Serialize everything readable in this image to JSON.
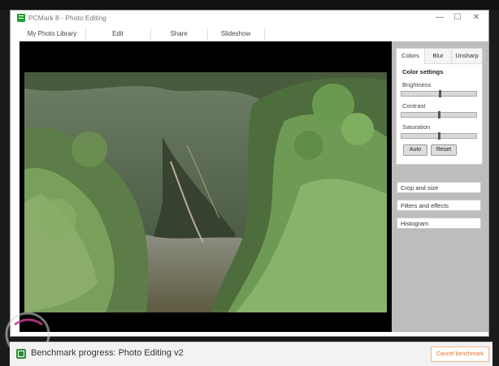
{
  "app": {
    "title": "PCMark 8 - Photo Editing"
  },
  "window_controls": {
    "minimize": "—",
    "maximize": "☐",
    "close": "✕"
  },
  "menu": {
    "items": [
      {
        "label": "My Photo Library"
      },
      {
        "label": "Edit"
      },
      {
        "label": "Share"
      },
      {
        "label": "Slideshow"
      }
    ]
  },
  "side_panel": {
    "tabs": [
      {
        "label": "Colors"
      },
      {
        "label": "Blur"
      },
      {
        "label": "Unsharp"
      }
    ],
    "color_settings": {
      "title": "Color settings",
      "brightness_label": "Brightness",
      "contrast_label": "Contrast",
      "saturation_label": "Saturation",
      "brightness_value": 0.52,
      "contrast_value": 0.5,
      "saturation_value": 0.5,
      "auto_label": "Auto",
      "reset_label": "Reset"
    },
    "sections": [
      {
        "label": "Crop and size"
      },
      {
        "label": "Filters and effects"
      },
      {
        "label": "Histogram"
      }
    ]
  },
  "progress": {
    "text": "Benchmark progress: Photo Editing v2",
    "cancel_label": "Cancel benchmark"
  },
  "colors": {
    "accent": "#e8702b",
    "panel_bg": "#bdbdbd",
    "brand_green": "#1f9d2a"
  }
}
